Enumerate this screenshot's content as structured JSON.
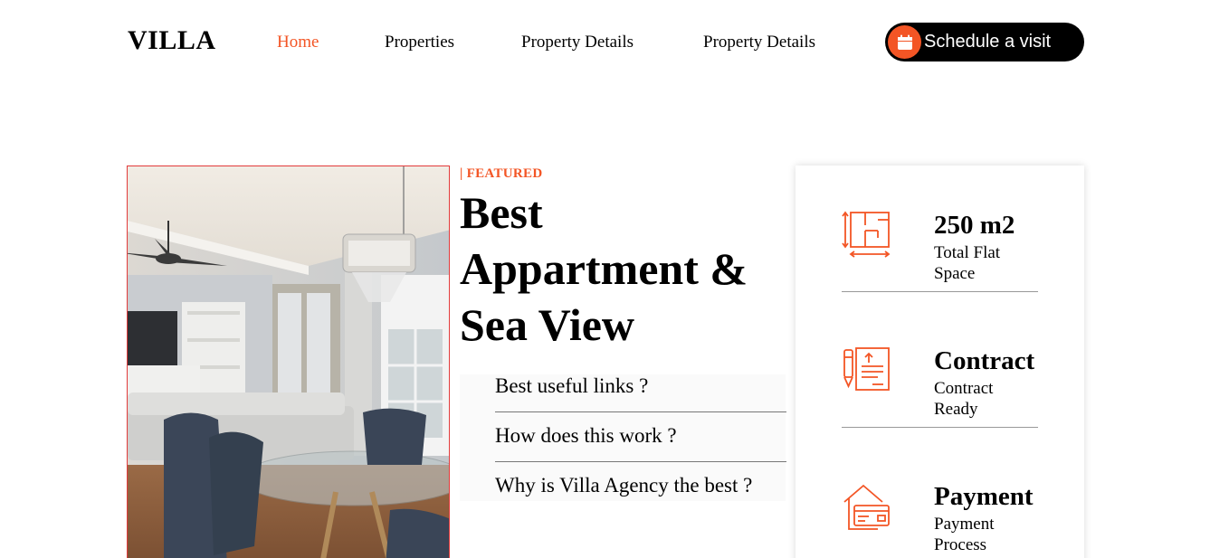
{
  "brand": {
    "logo": "VILLA",
    "accent_color": "#f35525"
  },
  "nav": {
    "items": [
      {
        "label": "Home",
        "active": true
      },
      {
        "label": "Properties",
        "active": false
      },
      {
        "label": "Property Details",
        "active": false
      },
      {
        "label": "Property Details",
        "active": false
      }
    ],
    "cta": {
      "label": "Schedule a visit",
      "icon": "calendar-icon"
    }
  },
  "featured": {
    "tag": "| FEATURED",
    "headline": "Best Appartment & Sea View",
    "faq": [
      "Best useful links ?",
      "How does this work ?",
      "Why is Villa Agency the best ?"
    ]
  },
  "info_card": {
    "items": [
      {
        "icon": "floor-plan-icon",
        "title": "250 m2",
        "subtitle": "Total Flat Space"
      },
      {
        "icon": "contract-icon",
        "title": "Contract",
        "subtitle": "Contract Ready"
      },
      {
        "icon": "payment-icon",
        "title": "Payment",
        "subtitle": "Payment Process"
      }
    ]
  }
}
